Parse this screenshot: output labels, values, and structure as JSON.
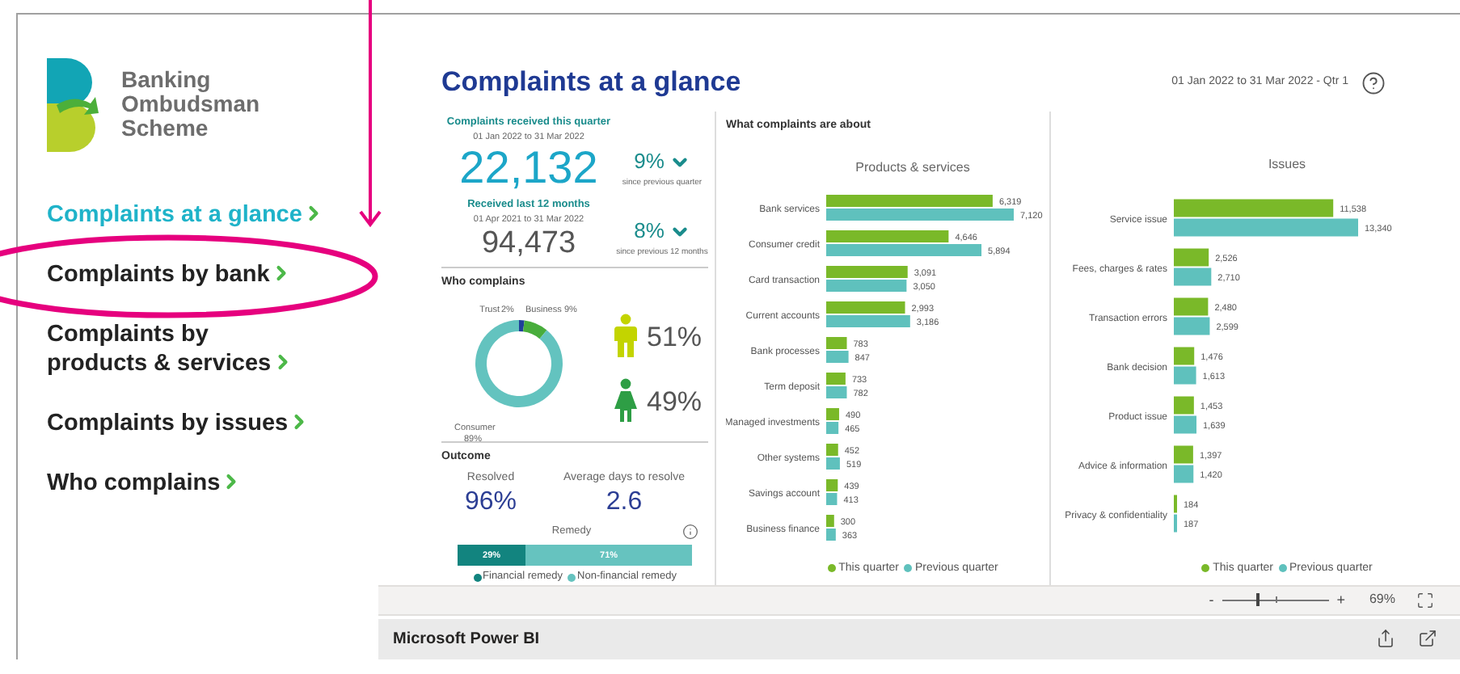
{
  "sidebar": {
    "brand": "Banking Ombudsman Scheme",
    "nav": [
      {
        "label": "Complaints at a glance",
        "selected": true
      },
      {
        "label": "Complaints by bank",
        "selected": false
      },
      {
        "label": "Complaints by\nproducts & services",
        "selected": false
      },
      {
        "label": "Complaints by issues",
        "selected": false
      },
      {
        "label": "Who complains",
        "selected": false
      }
    ]
  },
  "report": {
    "title": "Complaints at a glance",
    "period": "01 Jan 2022 to 31 Mar 2022 - Qtr 1",
    "kpis": [
      {
        "kind": "headline",
        "title": "Complaints received this quarter",
        "period": "01 Jan 2022 to 31 Mar 2022",
        "value": "22,132",
        "change": "9%",
        "change_note": "since previous quarter"
      },
      {
        "kind": "secondary",
        "title": "Received last 12 months",
        "period": "01 Apr 2021 to 31 Mar 2022",
        "value": "94,473",
        "change": "8%",
        "change_note": "since previous 12 months"
      }
    ],
    "who_complains": {
      "title": "Who complains",
      "chart_data": {
        "type": "donut",
        "categories": [
          "Trust",
          "Business",
          "Consumer"
        ],
        "values": [
          2,
          9,
          89
        ],
        "colors": [
          "#1f3f99",
          "#48ad3c",
          "#63c3bf"
        ],
        "value_labels": [
          "2%",
          "9%",
          "89%"
        ]
      },
      "gender": [
        {
          "value": "51%",
          "color": "#c3d400"
        },
        {
          "value": "49%",
          "color": "#2e9e45"
        }
      ]
    },
    "outcome": {
      "title": "Outcome",
      "stats": [
        {
          "label": "Resolved",
          "value": "96%"
        },
        {
          "label": "Average days to resolve",
          "value": "2.6"
        }
      ],
      "remedy": {
        "title": "Remedy",
        "level": 0.29,
        "segments": [
          {
            "label": "29%"
          },
          {
            "label": "71%"
          }
        ],
        "legend": [
          {
            "label": "Financial remedy",
            "color": "#12847f"
          },
          {
            "label": "Non-financial remedy",
            "color": "#66c3bf"
          }
        ]
      }
    },
    "about": {
      "title": "What complaints are about",
      "charts": [
        {
          "chart_data": {
            "type": "bar",
            "orientation": "horizontal",
            "title": "Products & services",
            "categories": [
              "Bank services",
              "Consumer credit",
              "Card transaction",
              "Current accounts",
              "Bank processes",
              "Term deposit",
              "Managed investments",
              "Other systems",
              "Savings account",
              "Business finance"
            ],
            "series": [
              {
                "name": "This quarter",
                "color": "#7ab929",
                "values": [
                  6319,
                  4646,
                  3091,
                  2993,
                  783,
                  733,
                  490,
                  452,
                  439,
                  300
                ],
                "value_labels": [
                  "6,319",
                  "4,646",
                  "3,091",
                  "2,993",
                  "783",
                  "733",
                  "490",
                  "452",
                  "439",
                  "300"
                ]
              },
              {
                "name": "Previous quarter",
                "color": "#5fc1bd",
                "values": [
                  7120,
                  5894,
                  3050,
                  3186,
                  847,
                  782,
                  465,
                  519,
                  413,
                  363
                ],
                "value_labels": [
                  "7,120",
                  "5,894",
                  "3,050",
                  "3,186",
                  "847",
                  "782",
                  "465",
                  "519",
                  "413",
                  "363"
                ]
              }
            ],
            "legend": "bottom"
          }
        },
        {
          "chart_data": {
            "type": "bar",
            "orientation": "horizontal",
            "title": "Issues",
            "categories": [
              "Service issue",
              "Fees, charges & rates",
              "Transaction errors",
              "Bank decision",
              "Product issue",
              "Advice & information",
              "Privacy & confidentiality"
            ],
            "series": [
              {
                "name": "This quarter",
                "color": "#7ab929",
                "values": [
                  11538,
                  2526,
                  2480,
                  1476,
                  1453,
                  1397,
                  184
                ],
                "value_labels": [
                  "11,538",
                  "2,526",
                  "2,480",
                  "1,476",
                  "1,453",
                  "1,397",
                  "184"
                ]
              },
              {
                "name": "Previous quarter",
                "color": "#5fc1bd",
                "values": [
                  13340,
                  2710,
                  2599,
                  1613,
                  1639,
                  1420,
                  187
                ],
                "value_labels": [
                  "13,340",
                  "2,710",
                  "2,599",
                  "1,613",
                  "1,639",
                  "1,420",
                  "187"
                ]
              }
            ],
            "legend": "bottom"
          }
        }
      ]
    }
  },
  "zoom": {
    "minus": "-",
    "plus": "+",
    "level": 0.33,
    "percent": "69%"
  },
  "footer": {
    "title": "Microsoft Power BI"
  }
}
